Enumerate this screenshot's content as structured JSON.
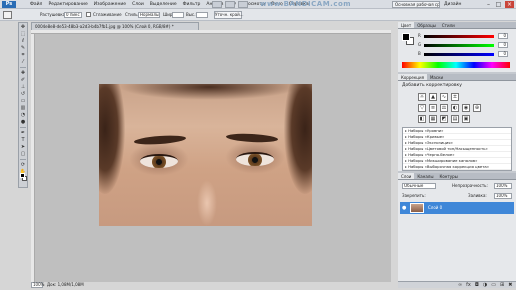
{
  "menubar": {
    "logo": "Ps",
    "items": [
      "Файл",
      "Редактирование",
      "Изображение",
      "Слои",
      "Выделение",
      "Фильтр",
      "Анализ",
      "3D",
      "Просмотр",
      "Окно",
      "Справка"
    ],
    "watermark": "www.BANDICAM.com",
    "workspace_button": "Основная рабочая среда",
    "workspace_label": "Дизайн",
    "window_controls": [
      "–",
      "□",
      "×"
    ]
  },
  "options_bar": {
    "feather_label": "Растушевка:",
    "feather_value": "0 пикс",
    "antialias_label": "Сглаживание",
    "style_label": "Стиль:",
    "style_value": "Нормальный",
    "width_label": "Шир.:",
    "height_label": "Выс.:",
    "refine_button": "Уточн. край..."
  },
  "document": {
    "tab_title": "0004e8e8-de53-48b3-a2d3-b4b7fb1.jpg @ 100% (Слой 0, RGB/8#) *",
    "zoom": "100%",
    "doc_info": "Док: 1,08М/1,08М"
  },
  "color_panel": {
    "tabs": [
      "Цвет",
      "Образцы",
      "Стили"
    ],
    "sliders": [
      {
        "label": "R",
        "value": "0"
      },
      {
        "label": "G",
        "value": "0"
      },
      {
        "label": "B",
        "value": "0"
      }
    ]
  },
  "adjustments_panel": {
    "tabs": [
      "Коррекция",
      "Маски"
    ],
    "title": "Добавить корректировку",
    "presets": [
      "Наборы «Уровни»",
      "Наборы «Кривые»",
      "Наборы «Экспозиция»",
      "Наборы «Цветовой тон/Насыщенность»",
      "Наборы «Черно-белое»",
      "Наборы «Микширование каналов»",
      "Наборы «Выборочная коррекция цвета»"
    ]
  },
  "layers_panel": {
    "tabs": [
      "Слои",
      "Каналы",
      "Контуры"
    ],
    "blend_mode": "Обычные",
    "opacity_label": "Непрозрачность:",
    "opacity_value": "100%",
    "lock_label": "Закрепить:",
    "fill_label": "Заливка:",
    "fill_value": "100%",
    "layer_name": "Слой 0"
  },
  "colors": {
    "accent": "#3f87d8",
    "chrome": "#d9dde3",
    "workspace": "#bfbfbf"
  }
}
